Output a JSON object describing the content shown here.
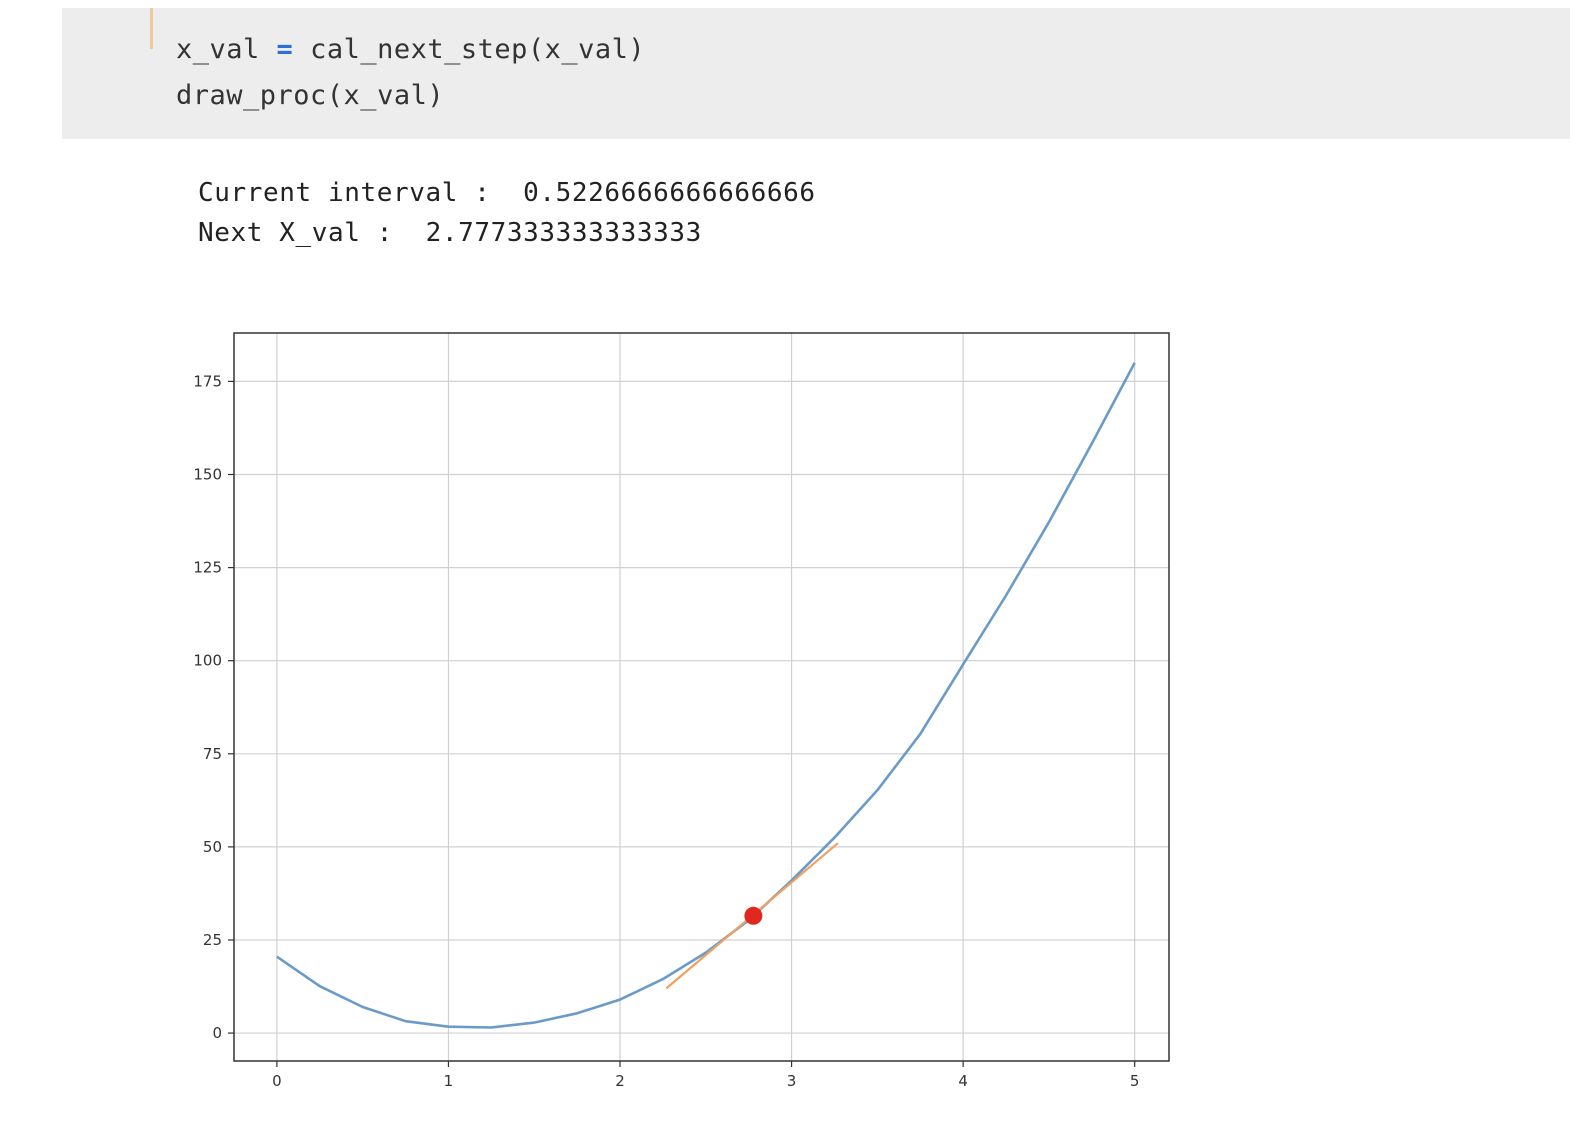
{
  "code_cell": {
    "line1": {
      "lhs": "x_val",
      "op": "=",
      "rhs": "cal_next_step(x_val)"
    },
    "line2": "draw_proc(x_val)"
  },
  "output": {
    "interval_label": "Current interval :",
    "interval_value": "0.5226666666666666",
    "next_label": "Next X_val :",
    "next_value": "2.777333333333333"
  },
  "colors": {
    "curve": "#6a9bc8",
    "tangent": "#f0a060",
    "point": "#e0281e",
    "grid": "#d0d0d0"
  },
  "chart_data": {
    "type": "line",
    "xlim": [
      -0.25,
      5.2
    ],
    "ylim": [
      -7.5,
      188
    ],
    "grid": true,
    "xticks": [
      0,
      1,
      2,
      3,
      4,
      5
    ],
    "yticks": [
      0,
      25,
      50,
      75,
      100,
      125,
      150,
      175
    ],
    "series": [
      {
        "kind": "curve",
        "x": [
          0,
          0.25,
          0.5,
          0.75,
          1,
          1.25,
          1.5,
          1.75,
          2,
          2.25,
          2.5,
          2.75,
          3,
          3.25,
          3.5,
          3.75,
          4,
          4.25,
          4.5,
          4.75,
          5
        ],
        "y": [
          20.5,
          12.6,
          7,
          3.2,
          1.7,
          1.5,
          2.8,
          5.3,
          9,
          14.5,
          21.6,
          30.3,
          41,
          52.5,
          65.2,
          80.3,
          99,
          117.5,
          137.2,
          158.3,
          180
        ]
      },
      {
        "kind": "tangent",
        "x": [
          2.27,
          3.27
        ],
        "y": [
          12,
          51
        ]
      },
      {
        "kind": "point",
        "x": [
          2.777333333333333
        ],
        "y": [
          31.5
        ]
      }
    ]
  }
}
